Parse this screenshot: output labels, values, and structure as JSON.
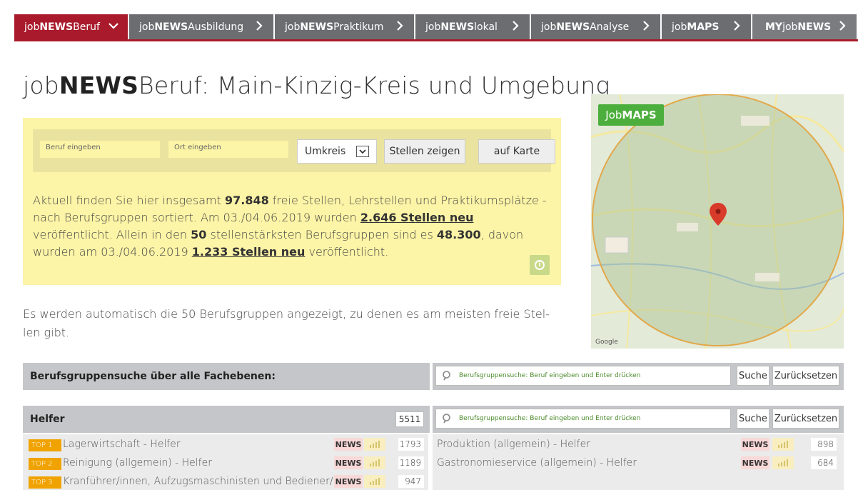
{
  "tabs": [
    {
      "pre": "job",
      "bold": "NEWS",
      "post": "Beruf",
      "chevron": "chevron-down-icon",
      "active": true
    },
    {
      "pre": "job",
      "bold": "NEWS",
      "post": "Ausbildung",
      "chevron": "chevron-right-icon"
    },
    {
      "pre": "job",
      "bold": "NEWS",
      "post": "Praktikum",
      "chevron": "chevron-right-icon"
    },
    {
      "pre": "job",
      "bold": "NEWS",
      "post": "lokal",
      "chevron": "chevron-right-icon"
    },
    {
      "pre": "job",
      "bold": "NEWS",
      "post": "Analyse",
      "chevron": "chevron-right-icon"
    },
    {
      "pre": "job",
      "bold": "MAPS",
      "post": "",
      "chevron": "chevron-right-icon"
    },
    {
      "pre": "",
      "bold": "MY",
      "post": "job",
      "post_bold": "NEWS",
      "chevron": "chevron-right-icon"
    }
  ],
  "title": {
    "pre": "job",
    "bold": "NEWS",
    "post": "Beruf: Main-Kinzig-Kreis und Umgebung"
  },
  "search": {
    "beruf_placeholder": "Beruf eingeben",
    "ort_placeholder": "Ort eingeben",
    "umkreis_label": "Umkreis",
    "show_button": "Stellen zeigen",
    "map_button": "auf Karte"
  },
  "summary": {
    "t1": "Aktuell finden Sie hier insgesamt ",
    "total": "97.848",
    "t2": " freie Stellen, Lehrstellen und Praktikumsplätze - nach Berufsgruppen sortiert. Am 03./04.06.2019 wurden ",
    "new1": "2.646 Stellen neu",
    "t3": " veröffentlicht. Allein in den ",
    "top": "50",
    "t4": " stellenstärksten Berufsgruppen sind es ",
    "subtotal": "48.300",
    "t5": ", davon wurden am 03./04.06.2019 ",
    "new2": "1.233 Stellen neu",
    "t6": " veröffentlicht."
  },
  "auto_text": "Es werden automatisch die 50 Berufsgruppen angezeigt, zu denen es am meisten freie Stel-len gibt.",
  "map": {
    "badge_pre": "Job",
    "badge_bold": "MAPS",
    "google": "Google"
  },
  "all_search": {
    "title": "Berufsgruppensuche über alle Fachebenen:",
    "placeholder": "Berufsgruppensuche: Beruf eingeben und Enter drücken",
    "search_btn": "Suche",
    "reset_btn": "Zurücksetzen"
  },
  "helfer": {
    "title": "Helfer",
    "count": "5511",
    "placeholder": "Berufsgruppensuche: Beruf eingeben und Enter drücken",
    "search_btn": "Suche",
    "reset_btn": "Zurücksetzen",
    "left_rows": [
      {
        "badge": "TOP 1",
        "label": "Lagerwirtschaft - Helfer",
        "news": "NEWS",
        "count": "1793"
      },
      {
        "badge": "TOP 2",
        "label": "Reinigung (allgemein) - Helfer",
        "news": "NEWS",
        "count": "1189"
      },
      {
        "badge": "TOP 3",
        "label": "Kranführer/innen, Aufzugsmaschinisten und Bediener/i",
        "news": "NEWS",
        "count": "947"
      }
    ],
    "right_rows": [
      {
        "label": "Produktion (allgemein) - Helfer",
        "news": "NEWS",
        "count": "898"
      },
      {
        "label": "Gastronomieservice (allgemein) - Helfer",
        "news": "NEWS",
        "count": "684"
      }
    ]
  }
}
